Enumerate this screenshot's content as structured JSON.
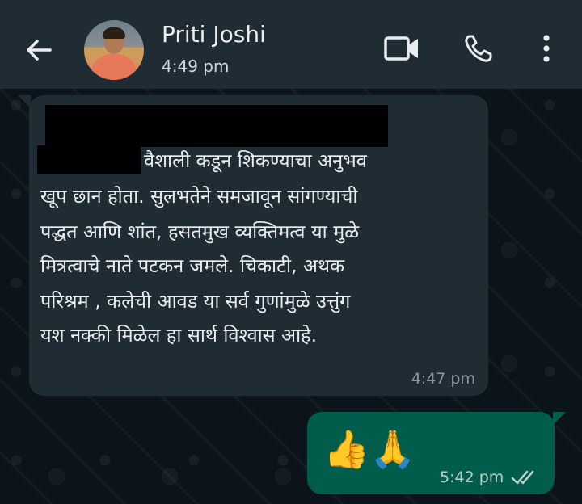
{
  "header": {
    "contact_name": "Priti Joshi",
    "last_seen": "4:49 pm",
    "icons": [
      "back-arrow-icon",
      "video-call-icon",
      "voice-call-icon",
      "more-options-icon"
    ]
  },
  "messages": [
    {
      "direction": "incoming",
      "redacted": true,
      "lines": [
        "वैशाली कडून शिकण्याचा अनुभव",
        "खूप छान होता. सुलभतेने समजावून सांगण्याची",
        "पद्धत आणि शांत, हसतमुख व्यक्तिमत्व या मुळे",
        "मित्रत्वाचे नाते पटकन जमले. चिकाटी, अथक",
        "परिश्रम , कलेची आवड या सर्व गुणांमुळे उत्तुंग",
        "यश नक्की मिळेल हा सार्थ विश्वास आहे."
      ],
      "time": "4:47 pm"
    },
    {
      "direction": "outgoing",
      "text": "👍🙏",
      "time": "5:42 pm",
      "status": "read"
    }
  ],
  "colors": {
    "header_bg": "#1f2c33",
    "chat_bg": "#0b141a",
    "incoming_bubble": "#202c33",
    "outgoing_bubble": "#005c4b"
  }
}
